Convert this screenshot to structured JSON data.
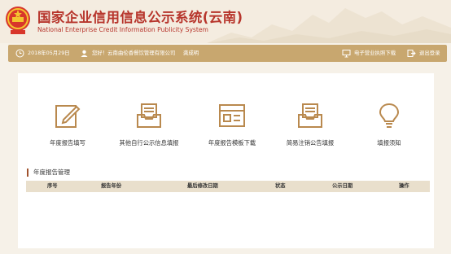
{
  "header": {
    "title_cn": "国家企业信用信息公示系统(云南)",
    "title_en": "National Enterprise Credit Information Publicity System"
  },
  "toolbar": {
    "date": "2018年05月29日",
    "greeting": "您好！云南曲伦香餐饮管理有限公司",
    "user": "龚成明",
    "license_download": "电子营业执照下载",
    "logout": "退出登录"
  },
  "tiles": [
    {
      "label": "年度报告填写",
      "icon": "edit-form-icon"
    },
    {
      "label": "其他自行公示信息填报",
      "icon": "inbox-document-icon"
    },
    {
      "label": "年度报告模板下载",
      "icon": "template-window-icon"
    },
    {
      "label": "简易注销公告填报",
      "icon": "inbox-document-icon"
    },
    {
      "label": "填报须知",
      "icon": "lightbulb-icon"
    }
  ],
  "section": {
    "title": "年度报告管理"
  },
  "table": {
    "columns": [
      "序号",
      "报告年份",
      "最后修改日期",
      "状态",
      "公示日期",
      "操作"
    ]
  },
  "colors": {
    "accent": "#c8a76f",
    "title_red": "#b7352c",
    "icon_brown": "#b9894e",
    "table_header": "#e9dfcc"
  }
}
